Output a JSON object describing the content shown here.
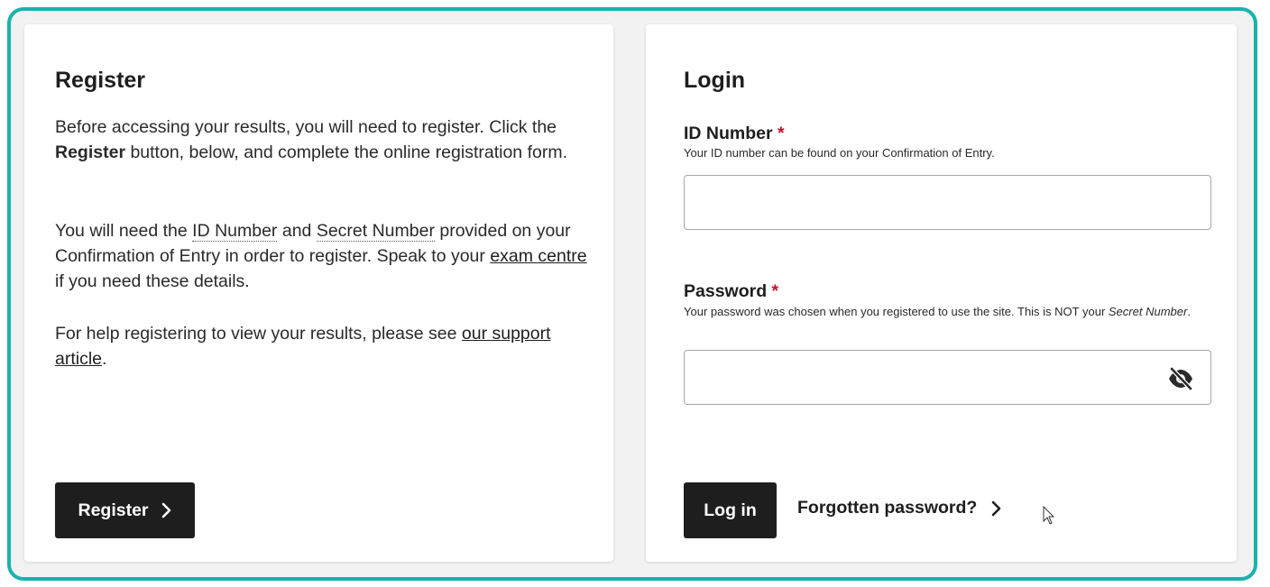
{
  "register": {
    "heading": "Register",
    "p1_a": "Before accessing your results, you will need to register. Click the ",
    "p1_bold": "Register",
    "p1_b": " button, below, and complete the online registration form.",
    "p2_a": "You will need the ",
    "p2_id": "ID Number",
    "p2_and": " and ",
    "p2_secret": "Secret Number",
    "p2_b": " provided on your Confirmation of Entry in order to register. Speak to your ",
    "p2_link": "exam centre",
    "p2_c": " if you need these details.",
    "p3_a": "For help registering to view your results, please see ",
    "p3_link": "our support article",
    "p3_b": ".",
    "button_label": "Register",
    "button_icon": "chevron-right-icon"
  },
  "login": {
    "heading": "Login",
    "id_label": "ID Number",
    "required_mark": "*",
    "id_hint": "Your ID number can be found on your Confirmation of Entry.",
    "id_value": "",
    "password_label": "Password",
    "password_hint_a": "Your password was chosen when you registered to use the site. This is NOT your ",
    "password_hint_em": "Secret Number",
    "password_hint_b": ".",
    "password_value": "",
    "password_toggle_icon": "eye-slash-icon",
    "login_button": "Log in",
    "forgot_link": "Forgotten password?",
    "forgot_icon": "chevron-right-icon"
  },
  "colors": {
    "frame_border": "#18b3ad",
    "background": "#f2f2f2",
    "button": "#1e1e1e",
    "required": "#c8102e"
  }
}
